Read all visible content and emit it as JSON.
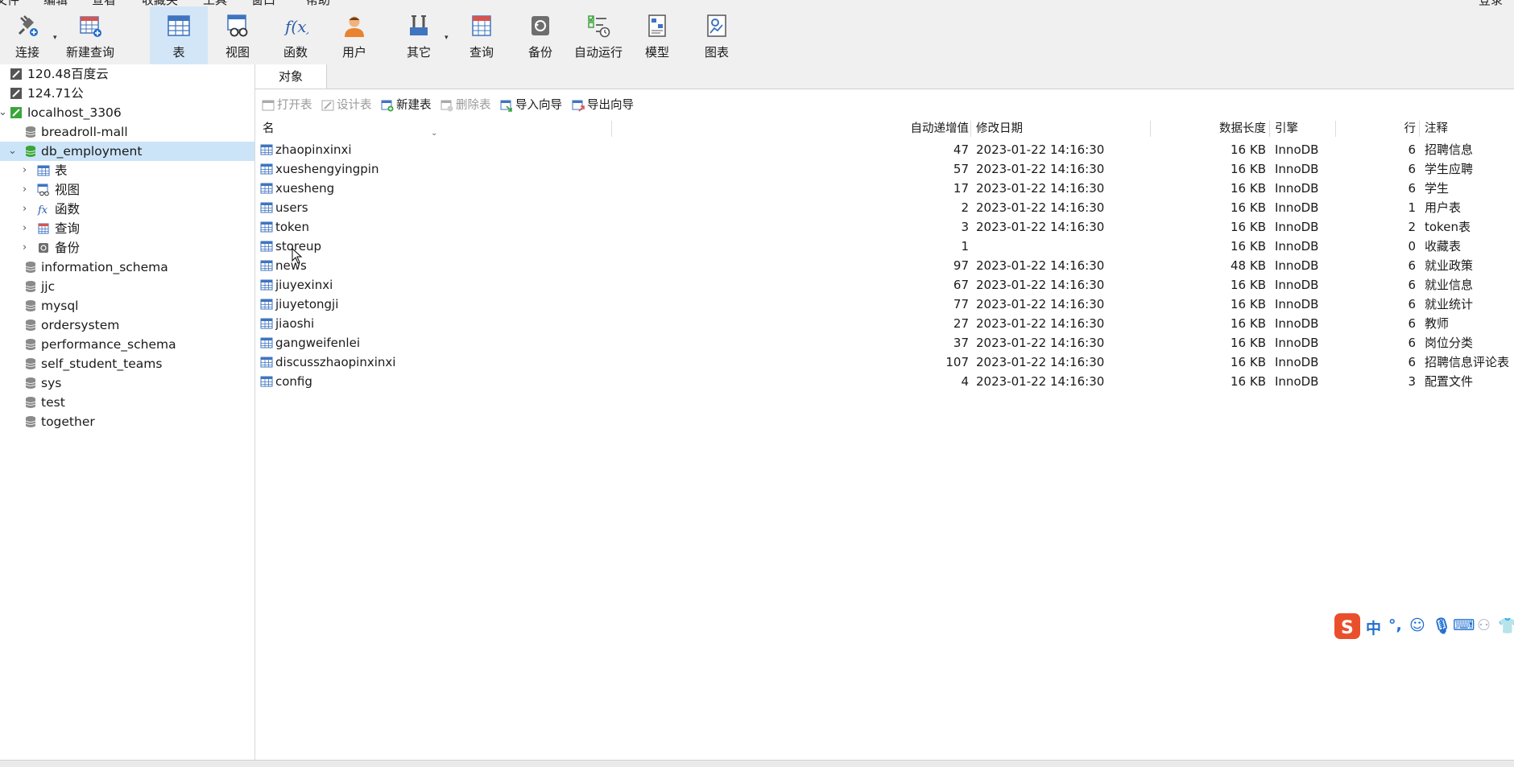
{
  "menubar": {
    "items": [
      "文件",
      "编辑",
      "查看",
      "收藏夹",
      "工具",
      "窗口",
      "帮助"
    ],
    "login": "登录"
  },
  "toolbar": {
    "connect": "连接",
    "new_query": "新建查询",
    "table": "表",
    "view": "视图",
    "function": "函数",
    "user": "用户",
    "other": "其它",
    "query": "查询",
    "backup": "备份",
    "auto_run": "自动运行",
    "model": "模型",
    "chart": "图表"
  },
  "sidebar": {
    "connections": [
      {
        "label": "120.48百度云"
      },
      {
        "label": "124.71公"
      },
      {
        "label": "localhost_3306"
      }
    ],
    "databases_top": [
      "breadroll-mall"
    ],
    "selected_db": "db_employment",
    "db_children": [
      {
        "label": "表",
        "icon": "table-icon"
      },
      {
        "label": "视图",
        "icon": "view-icon"
      },
      {
        "label": "函数",
        "icon": "function-icon"
      },
      {
        "label": "查询",
        "icon": "query-icon"
      },
      {
        "label": "备份",
        "icon": "backup-icon"
      }
    ],
    "databases_rest": [
      "information_schema",
      "jjc",
      "mysql",
      "ordersystem",
      "performance_schema",
      "self_student_teams",
      "sys",
      "test",
      "together"
    ]
  },
  "main": {
    "tab": "对象",
    "actions": {
      "open_table": "打开表",
      "design_table": "设计表",
      "new_table": "新建表",
      "delete_table": "删除表",
      "import_wizard": "导入向导",
      "export_wizard": "导出向导"
    },
    "columns": {
      "name": "名",
      "auto_inc": "自动递增值",
      "modified": "修改日期",
      "data_length": "数据长度",
      "engine": "引擎",
      "rows": "行",
      "comment": "注释"
    },
    "rows": [
      {
        "name": "zhaopinxinxi",
        "auto_inc": "47",
        "modified": "2023-01-22 14:16:30",
        "size": "16 KB",
        "engine": "InnoDB",
        "rows": "6",
        "comment": "招聘信息"
      },
      {
        "name": "xueshengyingpin",
        "auto_inc": "57",
        "modified": "2023-01-22 14:16:30",
        "size": "16 KB",
        "engine": "InnoDB",
        "rows": "6",
        "comment": "学生应聘"
      },
      {
        "name": "xuesheng",
        "auto_inc": "17",
        "modified": "2023-01-22 14:16:30",
        "size": "16 KB",
        "engine": "InnoDB",
        "rows": "6",
        "comment": "学生"
      },
      {
        "name": "users",
        "auto_inc": "2",
        "modified": "2023-01-22 14:16:30",
        "size": "16 KB",
        "engine": "InnoDB",
        "rows": "1",
        "comment": "用户表"
      },
      {
        "name": "token",
        "auto_inc": "3",
        "modified": "2023-01-22 14:16:30",
        "size": "16 KB",
        "engine": "InnoDB",
        "rows": "2",
        "comment": "token表"
      },
      {
        "name": "storeup",
        "auto_inc": "1",
        "modified": "",
        "size": "16 KB",
        "engine": "InnoDB",
        "rows": "0",
        "comment": "收藏表"
      },
      {
        "name": "news",
        "auto_inc": "97",
        "modified": "2023-01-22 14:16:30",
        "size": "48 KB",
        "engine": "InnoDB",
        "rows": "6",
        "comment": "就业政策"
      },
      {
        "name": "jiuyexinxi",
        "auto_inc": "67",
        "modified": "2023-01-22 14:16:30",
        "size": "16 KB",
        "engine": "InnoDB",
        "rows": "6",
        "comment": "就业信息"
      },
      {
        "name": "jiuyetongji",
        "auto_inc": "77",
        "modified": "2023-01-22 14:16:30",
        "size": "16 KB",
        "engine": "InnoDB",
        "rows": "6",
        "comment": "就业统计"
      },
      {
        "name": "jiaoshi",
        "auto_inc": "27",
        "modified": "2023-01-22 14:16:30",
        "size": "16 KB",
        "engine": "InnoDB",
        "rows": "6",
        "comment": "教师"
      },
      {
        "name": "gangweifenlei",
        "auto_inc": "37",
        "modified": "2023-01-22 14:16:30",
        "size": "16 KB",
        "engine": "InnoDB",
        "rows": "6",
        "comment": "岗位分类"
      },
      {
        "name": "discusszhaopinxinxi",
        "auto_inc": "107",
        "modified": "2023-01-22 14:16:30",
        "size": "16 KB",
        "engine": "InnoDB",
        "rows": "6",
        "comment": "招聘信息评论表"
      },
      {
        "name": "config",
        "auto_inc": "4",
        "modified": "2023-01-22 14:16:30",
        "size": "16 KB",
        "engine": "InnoDB",
        "rows": "3",
        "comment": "配置文件"
      }
    ]
  },
  "ime": {
    "logo": "S",
    "mode": "中",
    "punct": "°,"
  },
  "colors": {
    "accent": "#1f6fd0",
    "selection": "#cce4f7",
    "toolbar_active": "#d3e6f8",
    "db_green": "#3aa53a"
  }
}
